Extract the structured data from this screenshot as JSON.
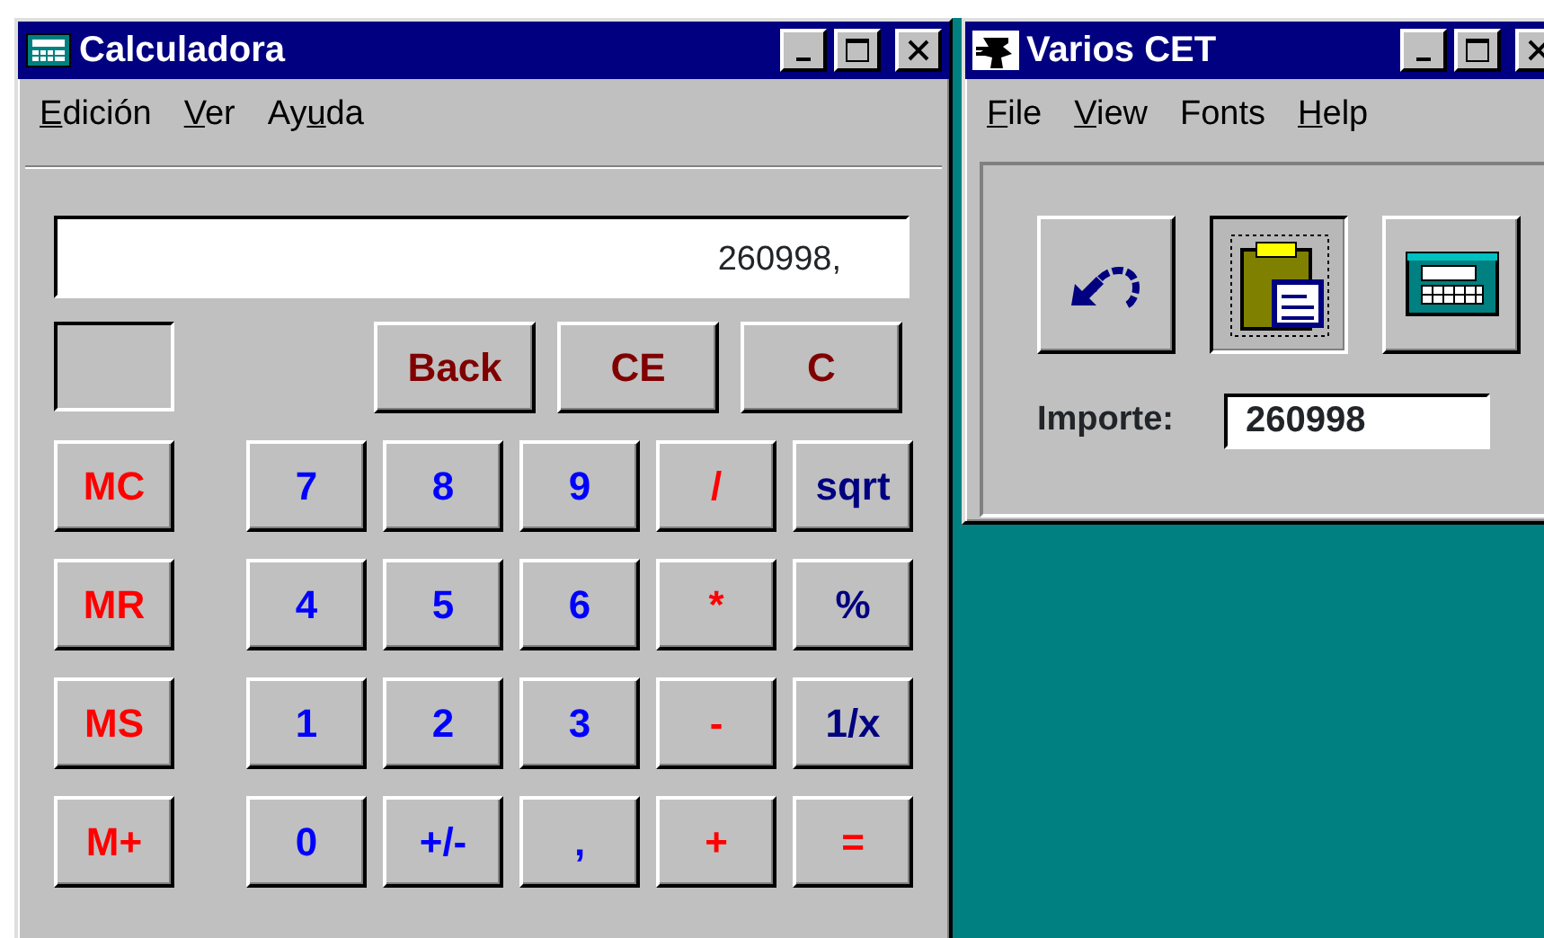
{
  "calculator": {
    "window": {
      "title": "Calculadora"
    },
    "menu": [
      {
        "key": "E",
        "after": "dición"
      },
      {
        "key": "V",
        "after": "er"
      },
      {
        "before": "Ay",
        "key": "u",
        "after": "da"
      }
    ],
    "display": "260998,",
    "memory_indicator": {
      "on": false
    },
    "top_keys": [
      {
        "label": "Back",
        "kind": "clear"
      },
      {
        "label": "CE",
        "kind": "clear"
      },
      {
        "label": "C",
        "kind": "clear"
      }
    ],
    "keys": [
      {
        "label": "MC",
        "kind": "memory"
      },
      {
        "label": "7",
        "kind": "digit"
      },
      {
        "label": "8",
        "kind": "digit"
      },
      {
        "label": "9",
        "kind": "digit"
      },
      {
        "label": "/",
        "kind": "operator"
      },
      {
        "label": "sqrt",
        "kind": "function"
      },
      {
        "label": "MR",
        "kind": "memory"
      },
      {
        "label": "4",
        "kind": "digit"
      },
      {
        "label": "5",
        "kind": "digit"
      },
      {
        "label": "6",
        "kind": "digit"
      },
      {
        "label": "*",
        "kind": "operator"
      },
      {
        "label": "%",
        "kind": "function"
      },
      {
        "label": "MS",
        "kind": "memory"
      },
      {
        "label": "1",
        "kind": "digit"
      },
      {
        "label": "2",
        "kind": "digit"
      },
      {
        "label": "3",
        "kind": "digit"
      },
      {
        "label": "-",
        "kind": "operator"
      },
      {
        "label": "1/x",
        "kind": "function"
      },
      {
        "label": "M+",
        "kind": "memory"
      },
      {
        "label": "0",
        "kind": "digit"
      },
      {
        "label": "+/-",
        "kind": "digit"
      },
      {
        "label": ",",
        "kind": "digit"
      },
      {
        "label": "+",
        "kind": "operator"
      },
      {
        "label": "=",
        "kind": "operator"
      }
    ]
  },
  "varios": {
    "window": {
      "title": "Varios CET"
    },
    "menu": [
      {
        "key": "F",
        "after": "ile"
      },
      {
        "key": "V",
        "after": "iew"
      },
      {
        "before": "Fonts"
      },
      {
        "key": "H",
        "after": "elp"
      }
    ],
    "tools": [
      {
        "kind": "undo",
        "pressed": false
      },
      {
        "kind": "paste",
        "pressed": true
      },
      {
        "kind": "calculator",
        "pressed": false
      }
    ],
    "amount": {
      "label": "Importe:",
      "value": "260998"
    }
  }
}
